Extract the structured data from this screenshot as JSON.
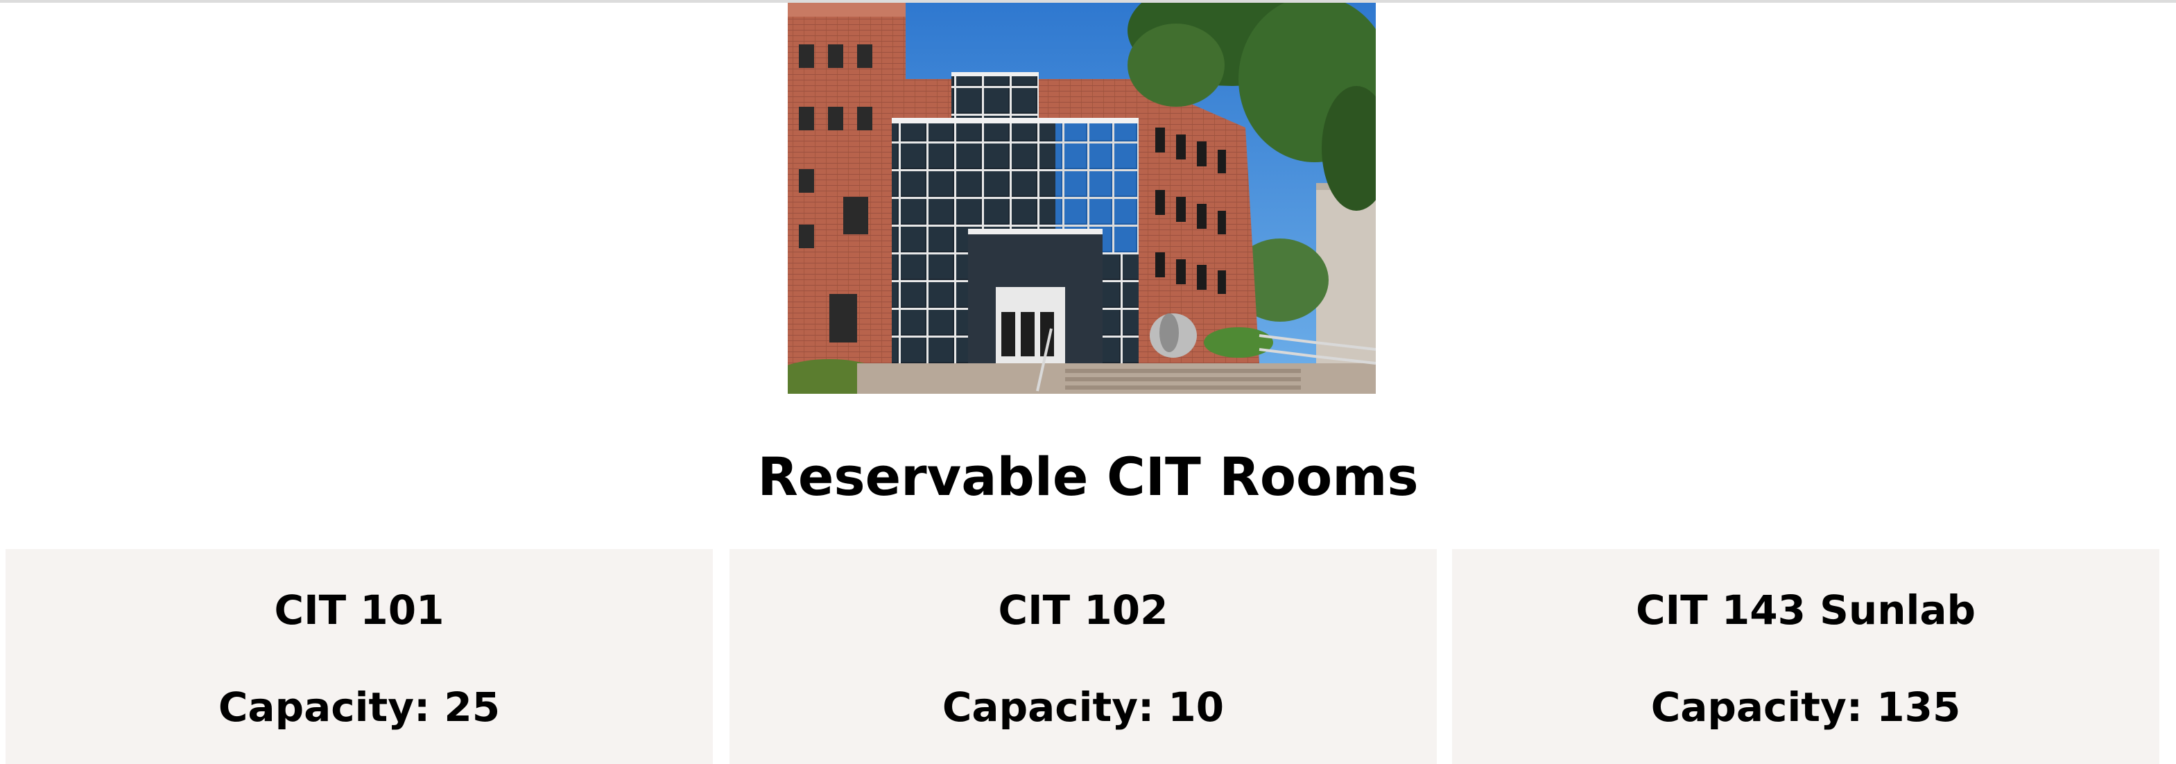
{
  "page": {
    "title": "Reservable CIT Rooms"
  },
  "rooms": [
    {
      "name": "CIT 101",
      "capacity": "Capacity: 25"
    },
    {
      "name": "CIT 102",
      "capacity": "Capacity: 10"
    },
    {
      "name": "CIT 143 Sunlab",
      "capacity": "Capacity: 135"
    }
  ],
  "colors": {
    "card_background": "#f6f3f1",
    "text": "#000000",
    "sky": "#3d86d6",
    "brick": "#b5604a",
    "glass": "#1d2a36"
  }
}
